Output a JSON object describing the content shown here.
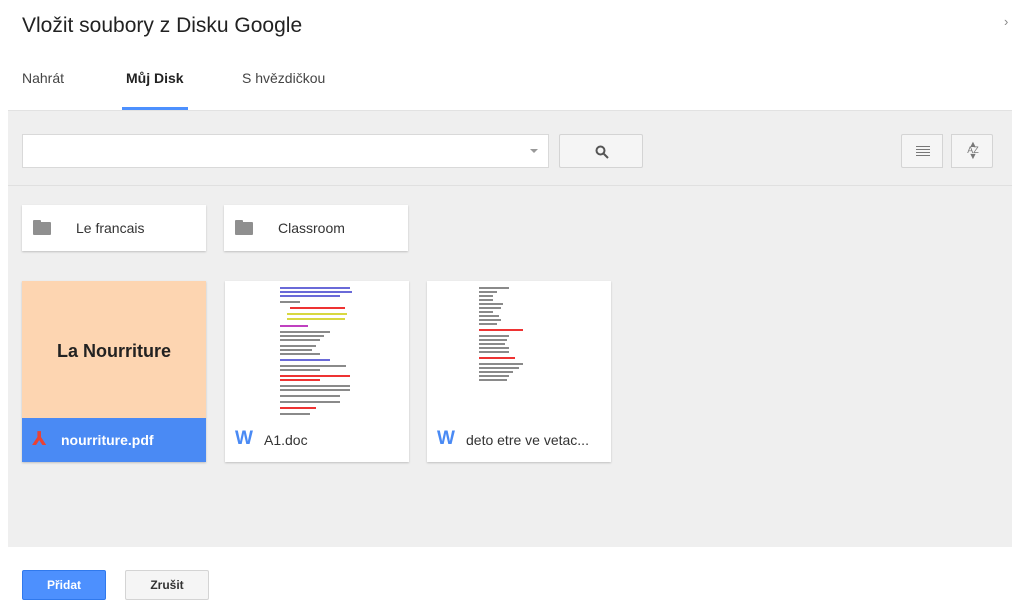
{
  "dialog": {
    "title": "Vložit soubory z Disku Google",
    "close": "›"
  },
  "tabs": [
    {
      "label": "Nahrát",
      "active": false
    },
    {
      "label": "Můj Disk",
      "active": true
    },
    {
      "label": "S hvězdičkou",
      "active": false
    }
  ],
  "toolbar": {
    "search_value": "",
    "sort_icon_text": "AZ"
  },
  "folders": [
    {
      "name": "Le francais"
    },
    {
      "name": "Classroom"
    }
  ],
  "files": [
    {
      "name": "nourriture.pdf",
      "type": "pdf",
      "thumbnail_title": "La Nourriture",
      "selected": true
    },
    {
      "name": "A1.doc",
      "type": "word",
      "selected": false
    },
    {
      "name": "deto etre ve vetac...",
      "type": "word",
      "selected": false
    }
  ],
  "icons": {
    "pdf": "pdf-icon",
    "word": "word-icon",
    "folder": "folder-icon",
    "search": "search-icon",
    "list": "list-view-icon",
    "sort": "sort-az-icon"
  },
  "footer": {
    "add_label": "Přidat",
    "cancel_label": "Zrušit"
  },
  "colors": {
    "accent": "#4d90fe",
    "selected": "#4a8af4",
    "pdf": "#e94235",
    "word": "#4a8af4"
  }
}
